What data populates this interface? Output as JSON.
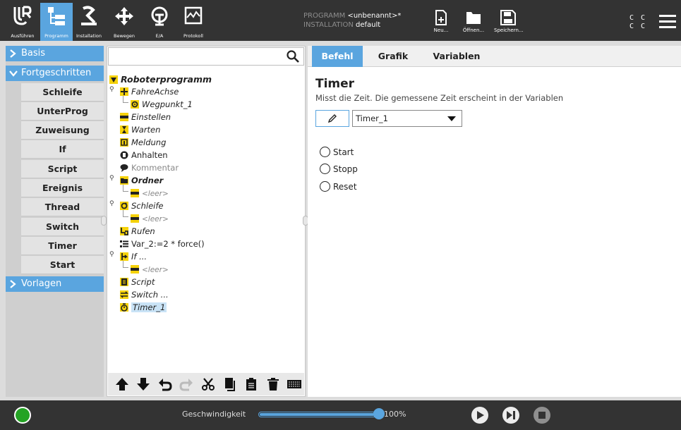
{
  "topbar": {
    "nav": [
      {
        "label": "Ausführen",
        "icon": "ur-logo-icon"
      },
      {
        "label": "Programm",
        "icon": "program-icon"
      },
      {
        "label": "Installation",
        "icon": "installation-icon"
      },
      {
        "label": "Bewegen",
        "icon": "move-icon"
      },
      {
        "label": "E/A",
        "icon": "io-icon"
      },
      {
        "label": "Protokoll",
        "icon": "log-icon"
      }
    ],
    "program_key": "PROGRAMM",
    "program_value": "<unbenannt>*",
    "installation_key": "INSTALLATION",
    "installation_value": "default",
    "new_label": "Neu...",
    "open_label": "Öffnen...",
    "save_label": "Speichern...",
    "cc_line1": "C C",
    "cc_line2": "C C"
  },
  "left": {
    "basis": "Basis",
    "advanced": "Fortgeschritten",
    "items": [
      "Schleife",
      "UnterProg",
      "Zuweisung",
      "If",
      "Script",
      "Ereignis",
      "Thread",
      "Switch",
      "Timer",
      "Start"
    ],
    "templates": "Vorlagen"
  },
  "tree": {
    "search_placeholder": "",
    "root": "Roboterprogramm",
    "nodes": [
      "FahreAchse",
      "Wegpunkt_1",
      "Einstellen",
      "Warten",
      "Meldung",
      "Anhalten",
      "Kommentar",
      "Ordner",
      "<leer>",
      "Schleife",
      "<leer>",
      "Rufen",
      "Var_2:=2 * force()",
      "If ...",
      "<leer>",
      "Script",
      "Switch ...",
      "Timer_1"
    ]
  },
  "right": {
    "tabs": [
      "Befehl",
      "Grafik",
      "Variablen"
    ],
    "title": "Timer",
    "description": "Misst die Zeit. Die gemessene Zeit erscheint in der Variablen",
    "variable": "Timer_1",
    "radios": [
      "Start",
      "Stopp",
      "Reset"
    ]
  },
  "bottom": {
    "speed_label": "Geschwindigkeit",
    "speed_percent": 100,
    "speed_value": "100%"
  },
  "colors": {
    "accent": "#5aa5df",
    "dark": "#333333",
    "power_green": "#24a324",
    "tree_yellow": "#f5d20a"
  }
}
